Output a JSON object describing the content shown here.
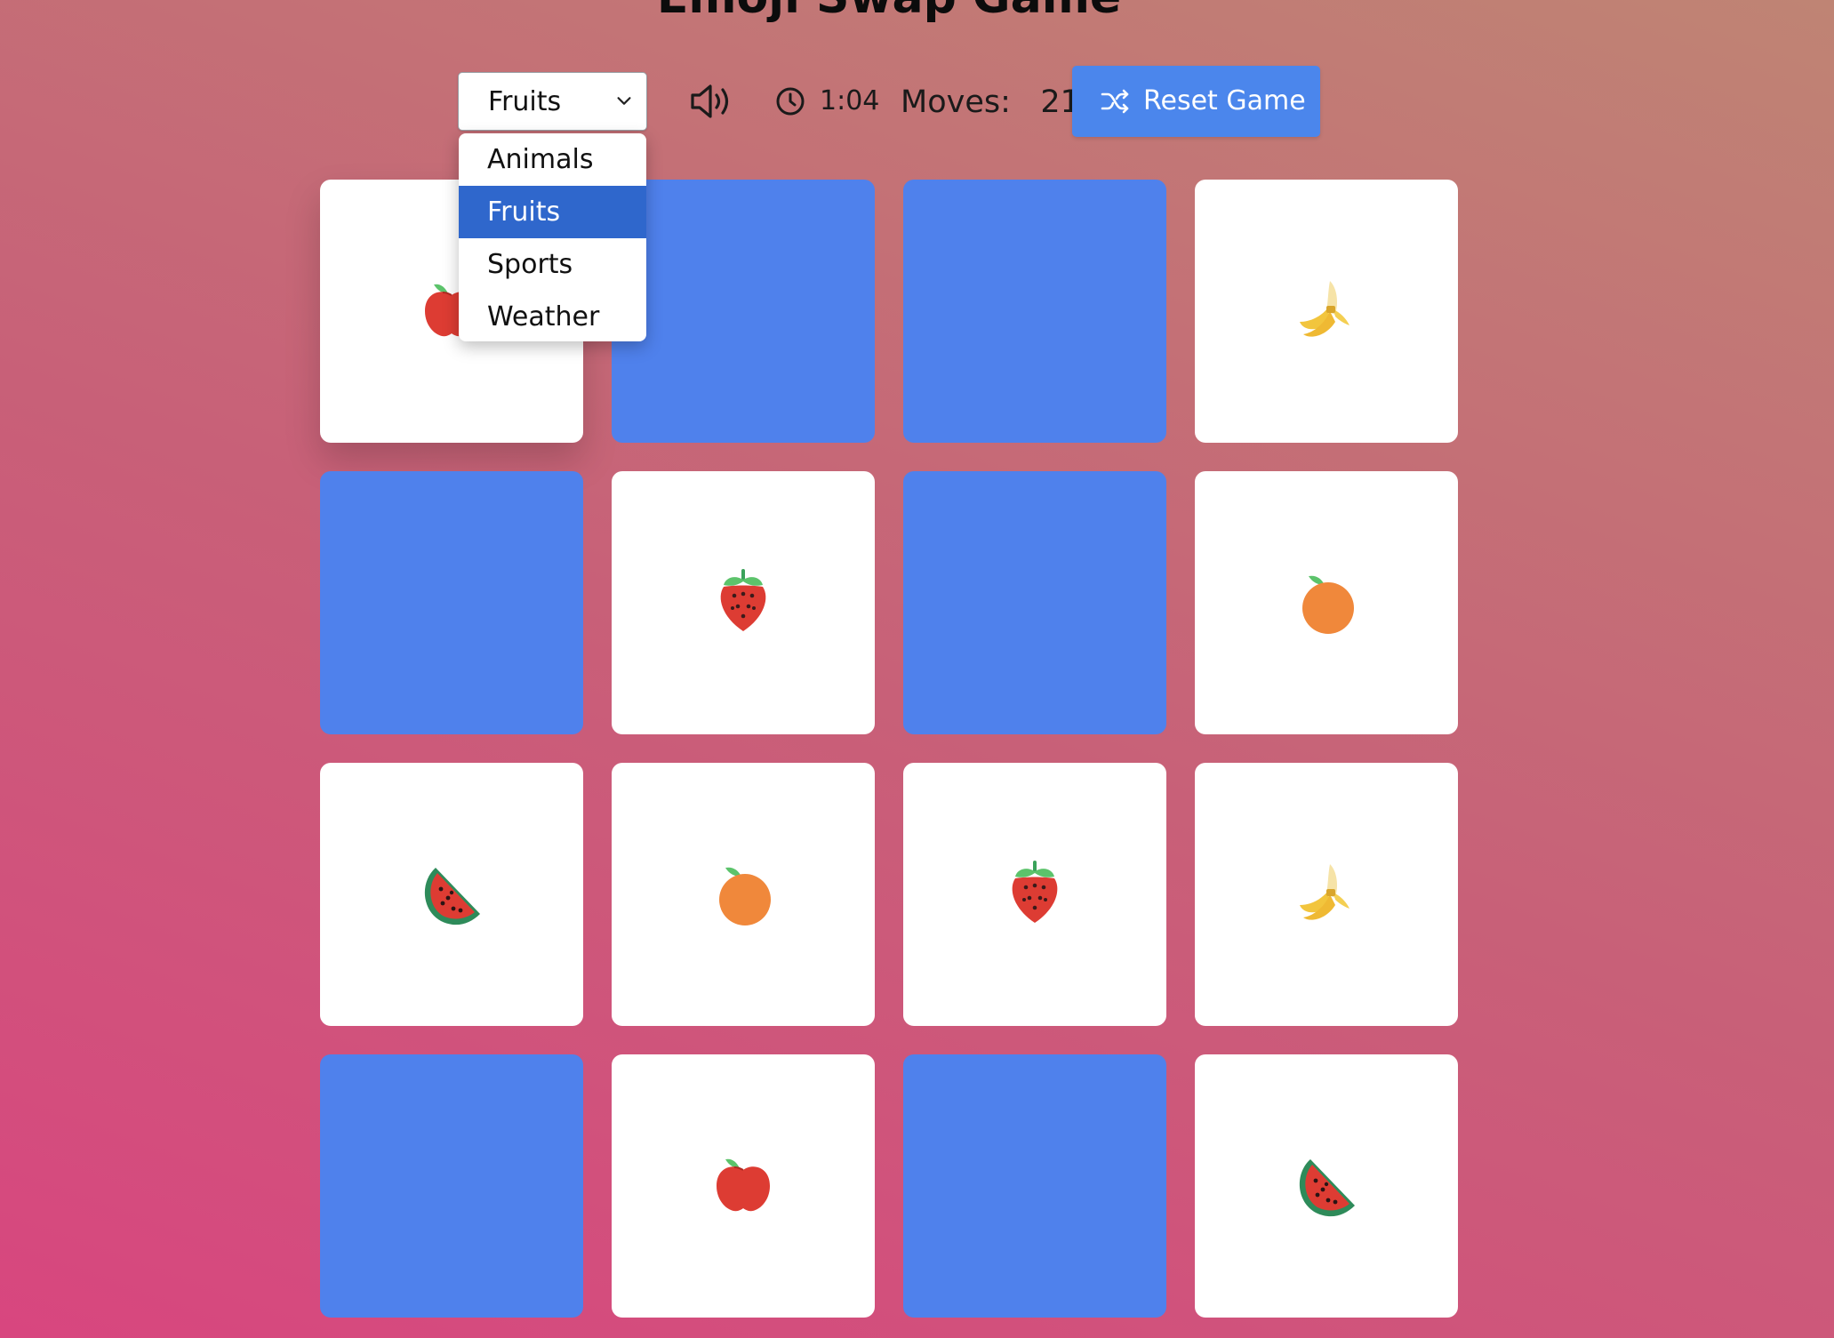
{
  "title": "Emoji Swap Game",
  "controls": {
    "category_selected": "Fruits",
    "category_options": [
      "Animals",
      "Fruits",
      "Sports",
      "Weather"
    ],
    "timer": "1:04",
    "moves_label": "Moves:",
    "moves_value": "21",
    "reset_label": "Reset Game"
  },
  "colors": {
    "card_back": "#4f81ec",
    "card_face": "#ffffff",
    "button": "#4b86ec",
    "selected_option": "#2f67cc"
  },
  "board": {
    "rows": 4,
    "cols": 4,
    "cards": [
      {
        "state": "revealed",
        "emoji": "apple"
      },
      {
        "state": "hidden",
        "emoji": ""
      },
      {
        "state": "hidden",
        "emoji": ""
      },
      {
        "state": "revealed",
        "emoji": "banana"
      },
      {
        "state": "hidden",
        "emoji": ""
      },
      {
        "state": "revealed",
        "emoji": "strawberry"
      },
      {
        "state": "hidden",
        "emoji": ""
      },
      {
        "state": "revealed",
        "emoji": "orange"
      },
      {
        "state": "revealed",
        "emoji": "watermelon"
      },
      {
        "state": "revealed",
        "emoji": "orange"
      },
      {
        "state": "revealed",
        "emoji": "strawberry"
      },
      {
        "state": "revealed",
        "emoji": "banana"
      },
      {
        "state": "hidden",
        "emoji": ""
      },
      {
        "state": "revealed",
        "emoji": "apple"
      },
      {
        "state": "hidden",
        "emoji": ""
      },
      {
        "state": "revealed",
        "emoji": "watermelon"
      }
    ]
  }
}
